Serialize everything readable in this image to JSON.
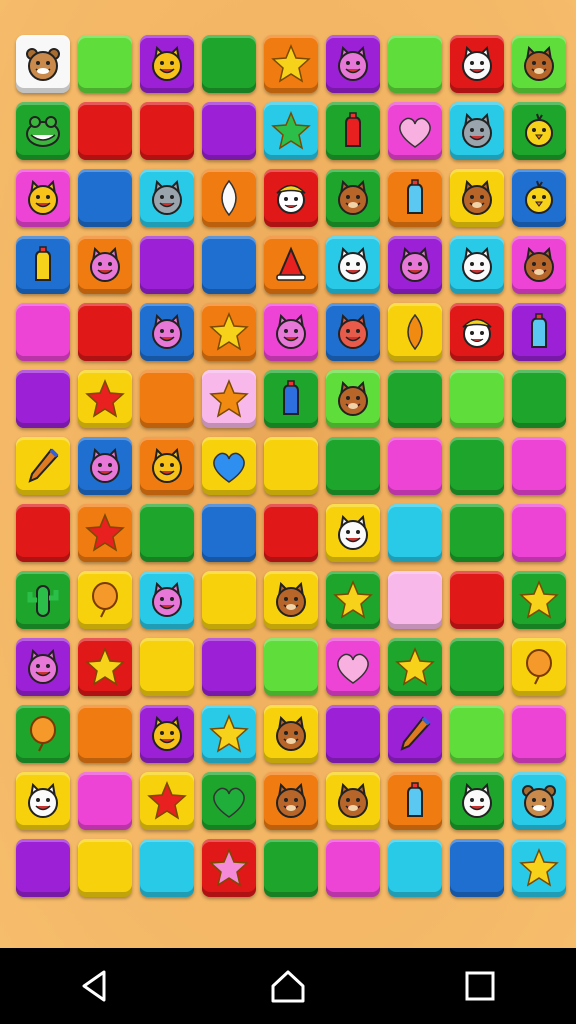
{
  "colors": {
    "W": "#f8f8f8",
    "L": "#5fde3b",
    "P": "#9b20d6",
    "G": "#1ea52c",
    "O": "#f07b10",
    "R": "#e01818",
    "C": "#29c9e8",
    "K": "#ee44d6",
    "Y": "#f7d20c",
    "B": "#1e6fd0",
    "k": "#f9b8ea"
  },
  "board": {
    "rows": [
      [
        {
          "c": "W",
          "i": "hamster"
        },
        {
          "c": "L"
        },
        {
          "c": "P",
          "i": "cat-yellow"
        },
        {
          "c": "G"
        },
        {
          "c": "O",
          "i": "star-yellow"
        },
        {
          "c": "P",
          "i": "cat-pink"
        },
        {
          "c": "L"
        },
        {
          "c": "R",
          "i": "cat-white"
        },
        {
          "c": "L",
          "i": "fox"
        }
      ],
      [
        {
          "c": "G",
          "i": "frog"
        },
        {
          "c": "R"
        },
        {
          "c": "R"
        },
        {
          "c": "P"
        },
        {
          "c": "C",
          "i": "star-green"
        },
        {
          "c": "G",
          "i": "bottle-red"
        },
        {
          "c": "K",
          "i": "heart-pink"
        },
        {
          "c": "C",
          "i": "cat-gray"
        },
        {
          "c": "G",
          "i": "chick"
        }
      ],
      [
        {
          "c": "K",
          "i": "cat-yellow"
        },
        {
          "c": "B"
        },
        {
          "c": "C",
          "i": "cat-gray"
        },
        {
          "c": "O",
          "i": "leaf-white"
        },
        {
          "c": "R",
          "i": "clown"
        },
        {
          "c": "G",
          "i": "fox"
        },
        {
          "c": "O",
          "i": "bottle-cyan"
        },
        {
          "c": "Y",
          "i": "fox"
        },
        {
          "c": "B",
          "i": "chick"
        }
      ],
      [
        {
          "c": "B",
          "i": "bottle-yellow"
        },
        {
          "c": "O",
          "i": "cat-pink"
        },
        {
          "c": "P"
        },
        {
          "c": "B"
        },
        {
          "c": "O",
          "i": "hat-red"
        },
        {
          "c": "C",
          "i": "cat-white"
        },
        {
          "c": "P",
          "i": "cat-pink"
        },
        {
          "c": "C",
          "i": "cat-white"
        },
        {
          "c": "K",
          "i": "fox"
        }
      ],
      [
        {
          "c": "K"
        },
        {
          "c": "R"
        },
        {
          "c": "B",
          "i": "cat-pink"
        },
        {
          "c": "O",
          "i": "star-yellow"
        },
        {
          "c": "K",
          "i": "cat-pink"
        },
        {
          "c": "B",
          "i": "cat-red"
        },
        {
          "c": "Y",
          "i": "leaf-orange"
        },
        {
          "c": "R",
          "i": "clown"
        },
        {
          "c": "P",
          "i": "bottle-cyan"
        }
      ],
      [
        {
          "c": "P"
        },
        {
          "c": "Y",
          "i": "star-red"
        },
        {
          "c": "O"
        },
        {
          "c": "k",
          "i": "star-orange"
        },
        {
          "c": "G",
          "i": "bottle-blue"
        },
        {
          "c": "L",
          "i": "fox"
        },
        {
          "c": "G"
        },
        {
          "c": "L"
        },
        {
          "c": "G"
        }
      ],
      [
        {
          "c": "Y",
          "i": "pen"
        },
        {
          "c": "B",
          "i": "cat-pink"
        },
        {
          "c": "O",
          "i": "cat-yellow"
        },
        {
          "c": "Y",
          "i": "heart-blue"
        },
        {
          "c": "Y"
        },
        {
          "c": "G"
        },
        {
          "c": "K"
        },
        {
          "c": "G"
        },
        {
          "c": "K"
        }
      ],
      [
        {
          "c": "R"
        },
        {
          "c": "O",
          "i": "star-red"
        },
        {
          "c": "G"
        },
        {
          "c": "B"
        },
        {
          "c": "R"
        },
        {
          "c": "Y",
          "i": "cat-white"
        },
        {
          "c": "C"
        },
        {
          "c": "G"
        },
        {
          "c": "K"
        }
      ],
      [
        {
          "c": "G",
          "i": "cactus"
        },
        {
          "c": "Y",
          "i": "balloon-orange"
        },
        {
          "c": "C",
          "i": "cat-pink"
        },
        {
          "c": "Y"
        },
        {
          "c": "Y",
          "i": "fox"
        },
        {
          "c": "G",
          "i": "star-yellow"
        },
        {
          "c": "k"
        },
        {
          "c": "R"
        },
        {
          "c": "G",
          "i": "star-yellow"
        }
      ],
      [
        {
          "c": "P",
          "i": "cat-pink"
        },
        {
          "c": "R",
          "i": "star-yellow"
        },
        {
          "c": "Y"
        },
        {
          "c": "P"
        },
        {
          "c": "L"
        },
        {
          "c": "K",
          "i": "heart-pink"
        },
        {
          "c": "G",
          "i": "star-yellow"
        },
        {
          "c": "G"
        },
        {
          "c": "Y",
          "i": "balloon-orange"
        }
      ],
      [
        {
          "c": "G",
          "i": "balloon-orange"
        },
        {
          "c": "O"
        },
        {
          "c": "P",
          "i": "cat-yellow"
        },
        {
          "c": "C",
          "i": "star-yellow"
        },
        {
          "c": "Y",
          "i": "fox"
        },
        {
          "c": "P"
        },
        {
          "c": "P",
          "i": "pen"
        },
        {
          "c": "L"
        },
        {
          "c": "K"
        }
      ],
      [
        {
          "c": "Y",
          "i": "cat-white"
        },
        {
          "c": "K"
        },
        {
          "c": "Y",
          "i": "star-red"
        },
        {
          "c": "G",
          "i": "heart-green"
        },
        {
          "c": "O",
          "i": "fox"
        },
        {
          "c": "Y",
          "i": "fox"
        },
        {
          "c": "O",
          "i": "bottle-cyan"
        },
        {
          "c": "G",
          "i": "cat-white"
        },
        {
          "c": "C",
          "i": "hamster"
        }
      ],
      [
        {
          "c": "P"
        },
        {
          "c": "Y"
        },
        {
          "c": "C"
        },
        {
          "c": "R",
          "i": "star-pink"
        },
        {
          "c": "G"
        },
        {
          "c": "K"
        },
        {
          "c": "C"
        },
        {
          "c": "B"
        },
        {
          "c": "C",
          "i": "star-yellow"
        }
      ]
    ]
  },
  "nav": {
    "buttons": [
      {
        "name": "back-button",
        "icon": "back-icon"
      },
      {
        "name": "home-button",
        "icon": "home-icon"
      },
      {
        "name": "recents-button",
        "icon": "recents-icon"
      }
    ]
  }
}
